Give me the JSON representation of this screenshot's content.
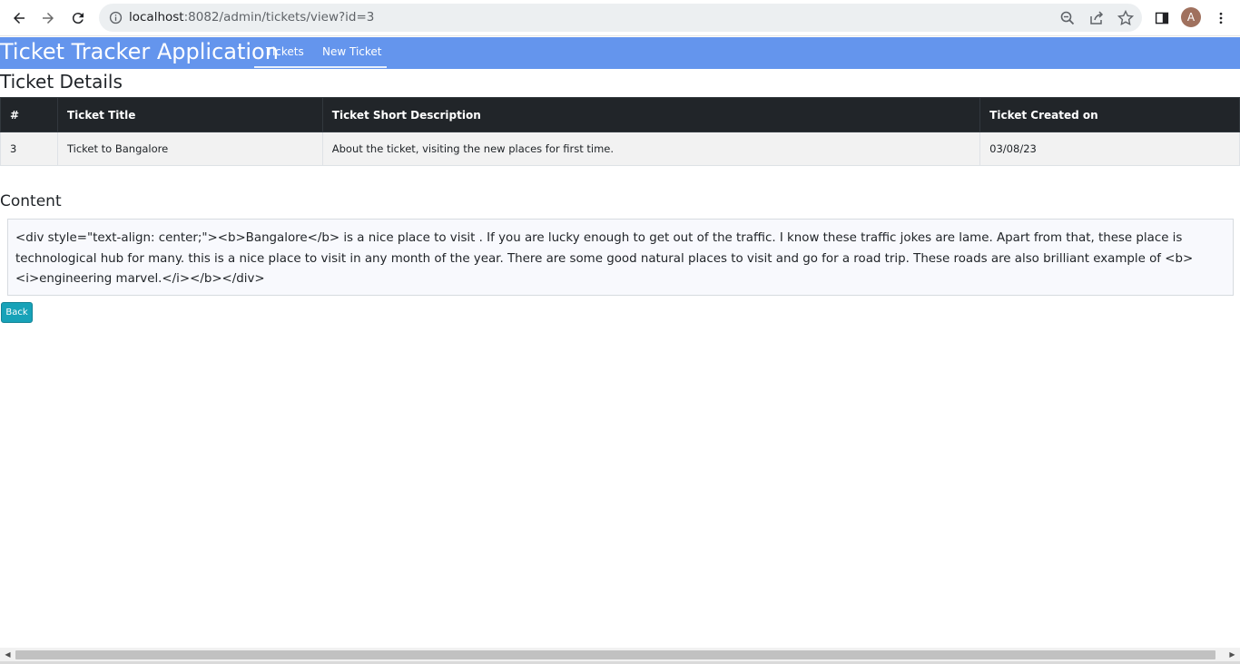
{
  "browser": {
    "url_host": "localhost",
    "url_path": ":8082/admin/tickets/view?id=3",
    "avatar_initial": "A",
    "icons": [
      "back-arrow-icon",
      "forward-arrow-icon",
      "reload-icon",
      "info-icon",
      "zoom-icon",
      "share-icon",
      "star-icon",
      "side-panel-icon",
      "kebab-menu-icon"
    ]
  },
  "navbar": {
    "brand": "Ticket Tracker Application",
    "links": [
      "Tickets",
      "New Ticket"
    ],
    "background": "#6495ed"
  },
  "page": {
    "title": "Ticket Details"
  },
  "table": {
    "headers": [
      "#",
      "Ticket Title",
      "Ticket Short Description",
      "Ticket Created on"
    ],
    "rows": [
      [
        "3",
        "Ticket to Bangalore",
        "About the ticket, visiting the new places for first time.",
        "03/08/23"
      ]
    ]
  },
  "content": {
    "title": "Content",
    "body": "<div style=\"text-align: center;\"><b>Bangalore</b> is a nice place to visit . If you are lucky enough to get out of the traffic. I know these traffic jokes are lame. Apart from that, these place is technological hub for many. this is a nice place to visit in any month of the year. There are some good natural places to visit and go for a road trip. These roads are also brilliant example of <b><i>engineering marvel.</i></b></div>"
  },
  "actions": {
    "back_label": "Back",
    "back_color": "#17a2b8"
  }
}
